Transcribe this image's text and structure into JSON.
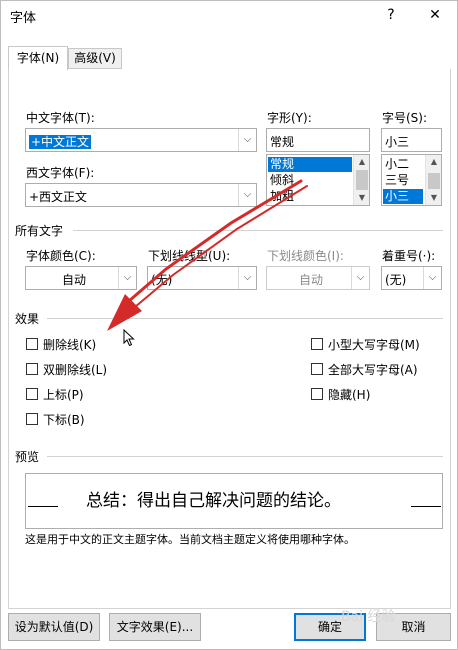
{
  "dialog": {
    "title": "字体",
    "help_label": "?",
    "close_label": "✕"
  },
  "tabs": [
    {
      "label": "字体(N)",
      "active": true
    },
    {
      "label": "高级(V)",
      "active": false
    }
  ],
  "chinese_font": {
    "label": "中文字体(T):",
    "value": "+中文正文"
  },
  "western_font": {
    "label": "西文字体(F):",
    "value": "+西文正文"
  },
  "font_style": {
    "label": "字形(Y):",
    "value": "常规",
    "options": [
      "常规",
      "倾斜",
      "加粗"
    ],
    "selected_index": 0
  },
  "font_size": {
    "label": "字号(S):",
    "value": "小三",
    "options": [
      "小二",
      "三号",
      "小三"
    ],
    "selected_index": 2
  },
  "all_text": {
    "heading": "所有文字",
    "font_color": {
      "label": "字体颜色(C):",
      "value": "自动"
    },
    "underline_style": {
      "label": "下划线线型(U):",
      "value": "(无)"
    },
    "underline_color": {
      "label": "下划线颜色(I):",
      "value": "自动"
    },
    "emphasis": {
      "label": "着重号(·):",
      "value": "(无)"
    }
  },
  "effects": {
    "heading": "效果",
    "left": [
      {
        "label": "删除线(K)",
        "checked": false
      },
      {
        "label": "双删除线(L)",
        "checked": false
      },
      {
        "label": "上标(P)",
        "checked": false
      },
      {
        "label": "下标(B)",
        "checked": false
      }
    ],
    "right": [
      {
        "label": "小型大写字母(M)",
        "checked": false
      },
      {
        "label": "全部大写字母(A)",
        "checked": false
      },
      {
        "label": "隐藏(H)",
        "checked": false
      }
    ]
  },
  "preview": {
    "heading": "预览",
    "sample": "总结：得出自己解决问题的结论。",
    "note": "这是用于中文的正文主题字体。当前文档主题定义将使用哪种字体。"
  },
  "buttons": {
    "set_default": "设为默认值(D)",
    "text_effects": "文字效果(E)...",
    "ok": "确定",
    "cancel": "取消"
  },
  "watermark": "Bai 经验",
  "colors": {
    "accent": "#0078d7",
    "annotation_arrow": "#d42a2a"
  }
}
